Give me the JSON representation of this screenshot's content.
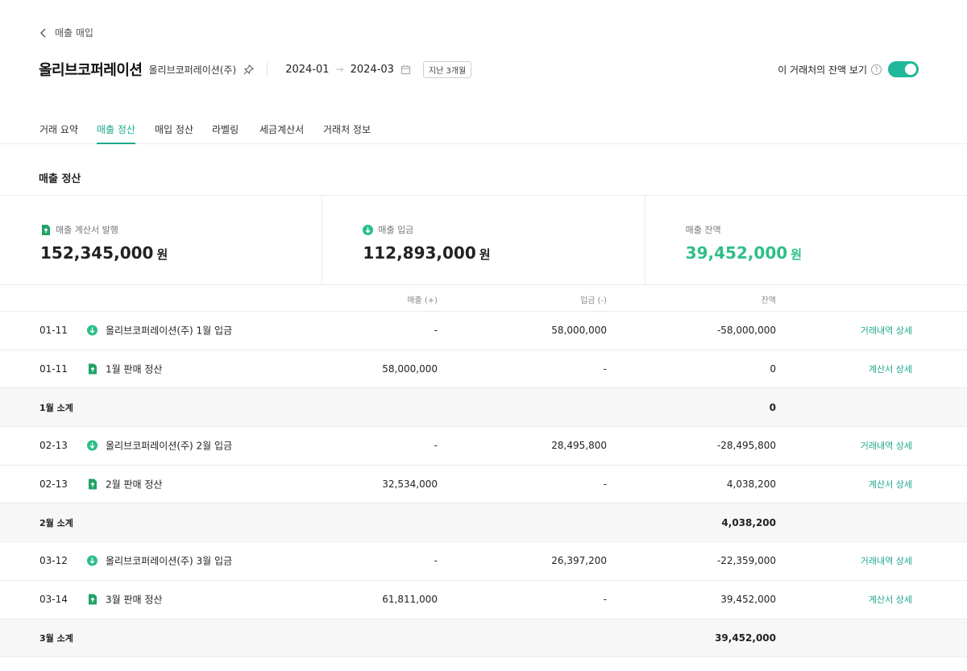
{
  "breadcrumb": {
    "back_label": "매출 매입"
  },
  "header": {
    "title": "올리브코퍼레이션",
    "subtitle": "올리브코퍼레이션(주)",
    "date_from": "2024-01",
    "date_arrow": "→",
    "date_to": "2024-03",
    "period_badge": "지난 3개월",
    "balance_toggle_label": "이 거래처의 잔액 보기",
    "help_glyph": "?",
    "balance_toggle_on": true
  },
  "tabs": [
    {
      "label": "거래 요약",
      "active": false
    },
    {
      "label": "매출 정산",
      "active": true
    },
    {
      "label": "매입 정산",
      "active": false
    },
    {
      "label": "라벨링",
      "active": false
    },
    {
      "label": "세금계산서",
      "active": false
    },
    {
      "label": "거래처 정보",
      "active": false
    }
  ],
  "section": {
    "title": "매출 정산"
  },
  "summary": [
    {
      "label": "매출 계산서 발행",
      "icon": "invoice-up-icon",
      "amount": "152,345,000",
      "unit": "원"
    },
    {
      "label": "매출 입금",
      "icon": "deposit-down-icon",
      "amount": "112,893,000",
      "unit": "원"
    },
    {
      "label": "매출 잔액",
      "icon": "",
      "amount": "39,452,000",
      "unit": "원"
    }
  ],
  "table": {
    "headers": {
      "sales": "매출 (+)",
      "deposit": "입금 (-)",
      "balance": "잔액"
    },
    "rows": [
      {
        "type": "item",
        "date": "01-11",
        "icon": "deposit-down-icon",
        "desc": "올리브코퍼레이션(주) 1월 입금",
        "sales": "-",
        "deposit": "58,000,000",
        "balance": "-58,000,000",
        "link": "거래내역 상세"
      },
      {
        "type": "item",
        "date": "01-11",
        "icon": "invoice-up-icon",
        "desc": "1월 판매 정산",
        "sales": "58,000,000",
        "deposit": "-",
        "balance": "0",
        "link": "계산서 상세"
      },
      {
        "type": "subtotal",
        "label": "1월 소계",
        "balance": "0"
      },
      {
        "type": "item",
        "date": "02-13",
        "icon": "deposit-down-icon",
        "desc": "올리브코퍼레이션(주) 2월 입금",
        "sales": "-",
        "deposit": "28,495,800",
        "balance": "-28,495,800",
        "link": "거래내역 상세"
      },
      {
        "type": "item",
        "date": "02-13",
        "icon": "invoice-up-icon",
        "desc": "2월 판매 정산",
        "sales": "32,534,000",
        "deposit": "-",
        "balance": "4,038,200",
        "link": "계산서 상세"
      },
      {
        "type": "subtotal",
        "label": "2월 소계",
        "balance": "4,038,200"
      },
      {
        "type": "item",
        "date": "03-12",
        "icon": "deposit-down-icon",
        "desc": "올리브코퍼레이션(주) 3월 입금",
        "sales": "-",
        "deposit": "26,397,200",
        "balance": "-22,359,000",
        "link": "거래내역 상세"
      },
      {
        "type": "item",
        "date": "03-14",
        "icon": "invoice-up-icon",
        "desc": "3월 판매 정산",
        "sales": "61,811,000",
        "deposit": "-",
        "balance": "39,452,000",
        "link": "계산서 상세"
      },
      {
        "type": "subtotal",
        "label": "3월 소계",
        "balance": "39,452,000"
      }
    ]
  },
  "colors": {
    "accent": "#1fa88e",
    "positive": "#2cbf88",
    "icon_green": "#21a366"
  }
}
